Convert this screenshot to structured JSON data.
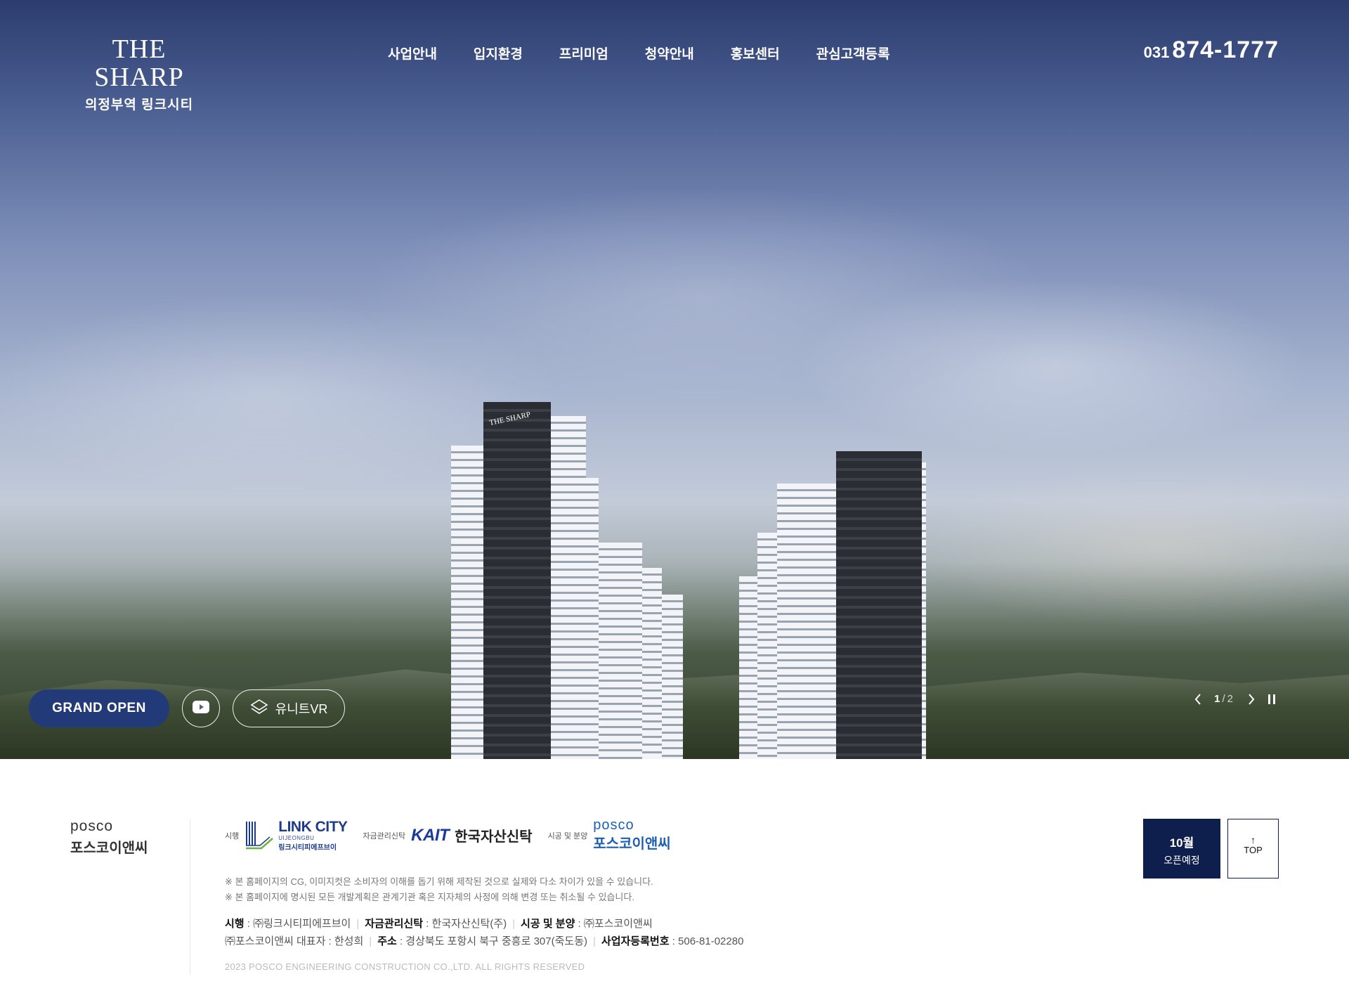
{
  "header": {
    "logo_brand": "THE SHARP",
    "logo_sub": "의정부역 링크시티",
    "nav": [
      "사업안내",
      "입지환경",
      "프리미엄",
      "청약안내",
      "홍보센터",
      "관심고객등록"
    ],
    "phone_area": "031",
    "phone_number": "874-1777"
  },
  "hero": {
    "grand_open_label": "GRAND OPEN",
    "vr_label": "유니트VR",
    "slide_current": "1",
    "slide_separator": "/",
    "slide_total": "2",
    "building_sign": "THE SHARP"
  },
  "footer": {
    "logo_en": "posco",
    "logo_ko": "포스코이앤씨",
    "partners": {
      "developer_role": "시행",
      "developer_name": "LINK CITY",
      "developer_sub": "UIJEONGBU",
      "developer_ko": "링크시티피에프브이",
      "trust_role": "자금관리신탁",
      "trust_logo": "KAIT",
      "trust_name": "한국자산신탁",
      "builder_role": "시공 및 분양",
      "builder_en": "posco",
      "builder_ko": "포스코이앤씨"
    },
    "notes": [
      "※ 본 홈페이지의 CG, 이미지컷은 소비자의 이해를 돕기 위해 제작된 것으로 실제와 다소 차이가 있을 수 있습니다.",
      "※ 본 홈페이지에 명시된 모든 개발계획은 관계기관 혹은 지자체의 사정에 의해 변경 또는 취소될 수 있습니다."
    ],
    "info": {
      "developer_label": "시행",
      "developer_value": " : ㈜링크시티피에프브이",
      "trust_label": "자금관리신탁",
      "trust_value": " : 한국자산신탁(주)",
      "builder_label": "시공 및 분양",
      "builder_value": " : ㈜포스코이앤씨",
      "ceo_value": "㈜포스코이앤씨 대표자 : 한성희",
      "address_label": "주소",
      "address_value": " : 경상북도 포항시 북구 중흥로 307(죽도동)",
      "bizno_label": "사업자등록번호",
      "bizno_value": " : 506-81-02280"
    },
    "copyright": "2023 POSCO ENGINEERING CONSTRUCTION CO.,LTD. ALL RIGHTS RESERVED",
    "open_month": "10월",
    "open_text": "오픈예정",
    "top_label": "TOP"
  },
  "colors": {
    "brand_navy": "#0f1f4d",
    "grand_open_bg": "#233a78",
    "posco_blue": "#1d5fb3"
  }
}
